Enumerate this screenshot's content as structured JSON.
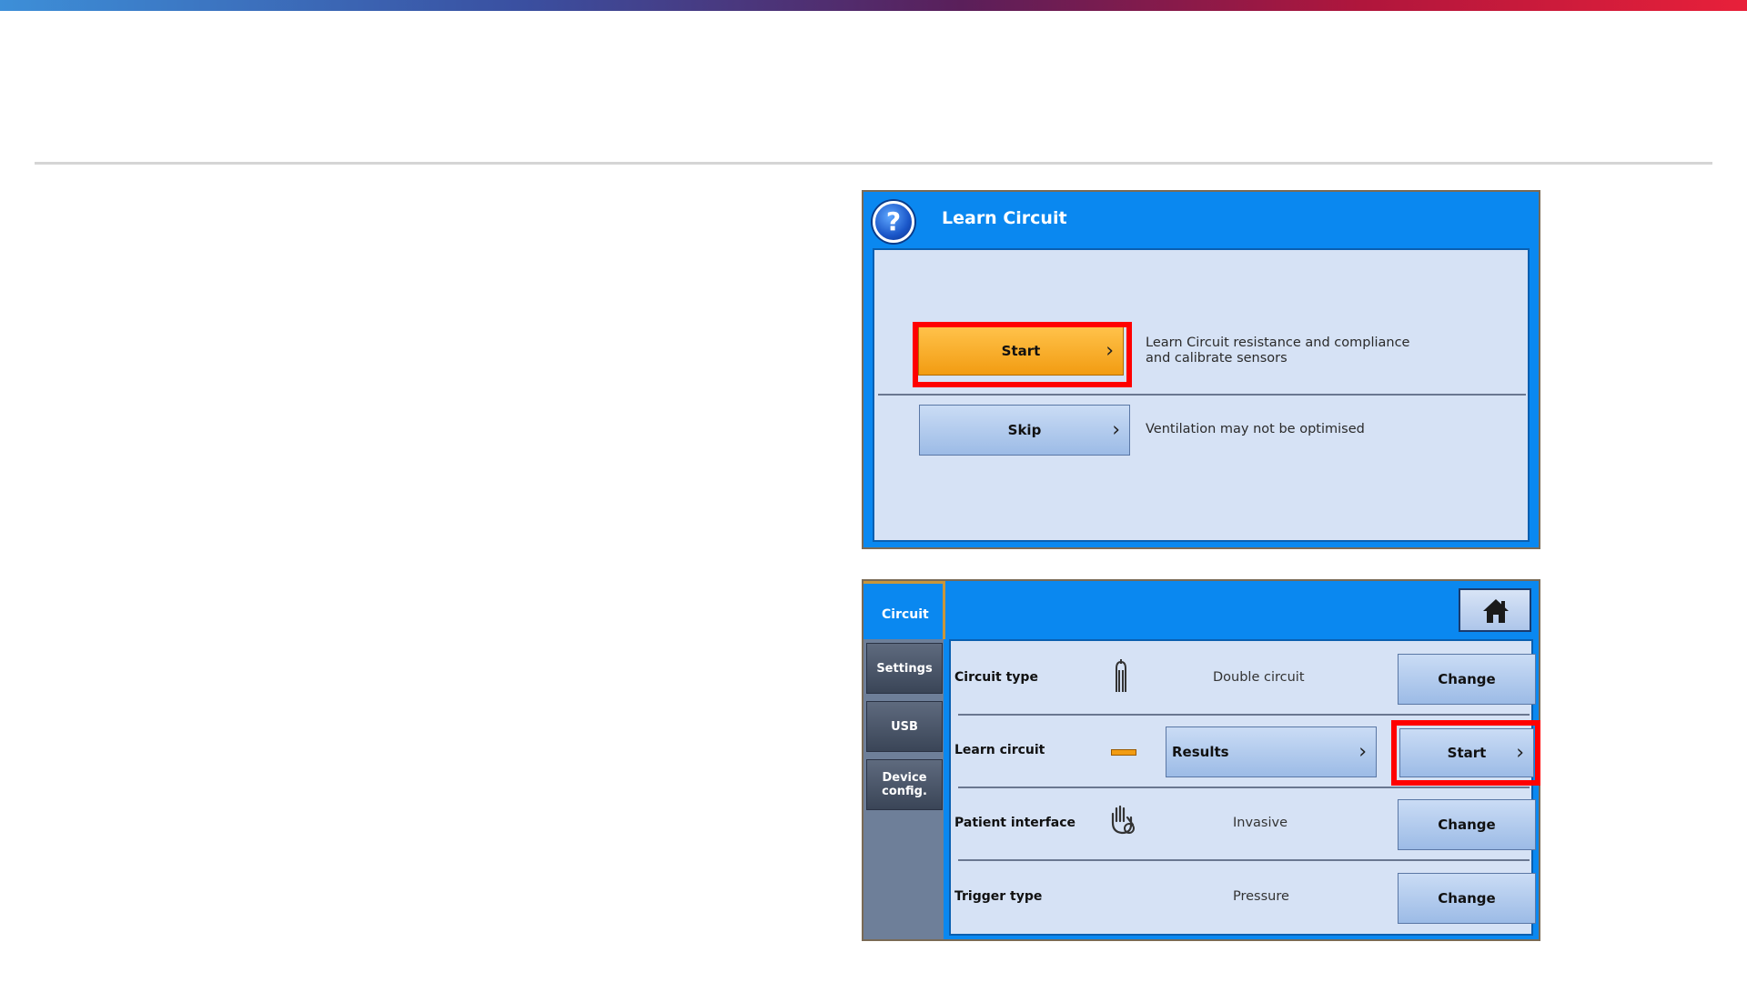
{
  "learn_circuit_dialog": {
    "title": "Learn Circuit",
    "start_button": "Start",
    "start_description_line1": "Learn Circuit resistance and compliance",
    "start_description_line2": "and calibrate sensors",
    "skip_button": "Skip",
    "skip_description": "Ventilation may not be optimised"
  },
  "circuit_screen": {
    "active_tab": "Circuit",
    "side_tabs": [
      "Settings",
      "USB"
    ],
    "device_config_line1": "Device",
    "device_config_line2": "config.",
    "rows": [
      {
        "label": "Circuit type",
        "value": "Double circuit",
        "button": "Change"
      },
      {
        "label": "Learn circuit",
        "results_button": "Results",
        "button": "Start"
      },
      {
        "label": "Patient interface",
        "value": "Invasive",
        "button": "Change"
      },
      {
        "label": "Trigger type",
        "value": "Pressure",
        "button": "Change"
      }
    ]
  },
  "colors": {
    "header_blue": "#0a88f0",
    "panel_bg": "#d6e2f5",
    "highlight_red": "#ff0000",
    "start_orange": "#f29c12"
  },
  "icons": {
    "help": "question-mark-icon",
    "home": "home-icon",
    "chevron": "chevron-right-icon",
    "circuit_type": "double-circuit-icon",
    "learn_status": "status-bar-icon",
    "patient_interface": "hand-icon"
  }
}
